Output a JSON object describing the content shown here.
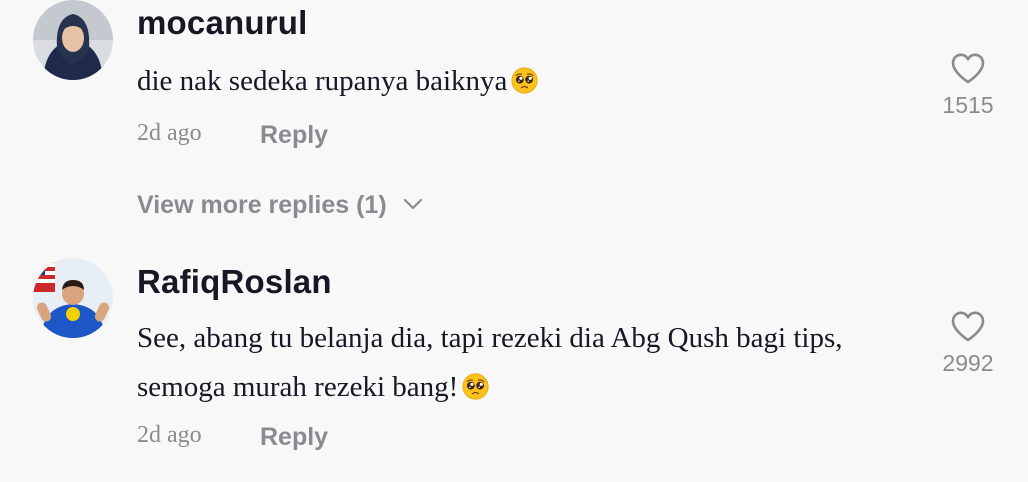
{
  "comments": [
    {
      "username": "mocanurul",
      "text": "die nak sedeka rupanya baiknya",
      "emoji": "pleading-face-emoji",
      "time": "2d ago",
      "reply_label": "Reply",
      "likes": "1515"
    },
    {
      "username": "RafiqRoslan",
      "text": "See, abang tu belanja dia, tapi rezeki dia Abg Qush bagi tips, semoga murah rezeki bang!",
      "emoji": "pleading-face-emoji",
      "time": "2d ago",
      "reply_label": "Reply",
      "likes": "2992"
    }
  ],
  "view_more_replies": {
    "label": "View more replies (1)",
    "icon": "chevron-down-icon"
  },
  "colors": {
    "background": "#f8f8f8",
    "primary_text": "#161823",
    "secondary_text": "#8a8b91"
  }
}
